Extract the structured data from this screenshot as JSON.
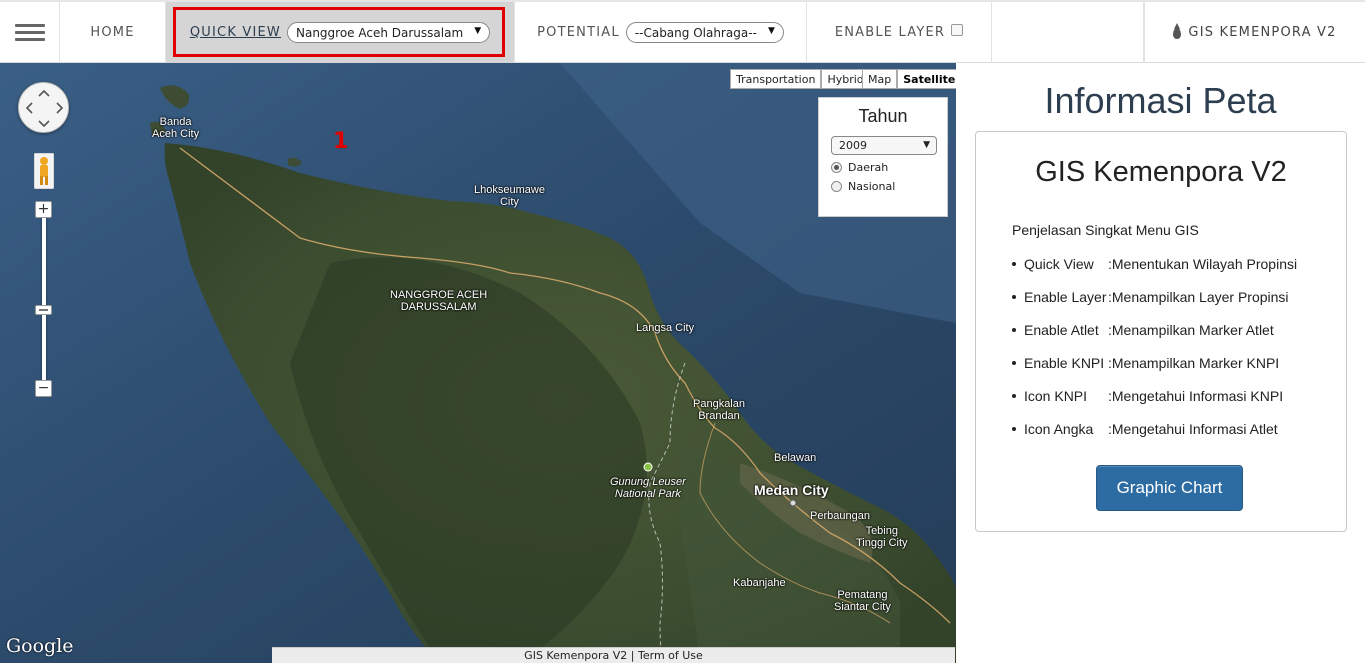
{
  "nav": {
    "home": "HOME",
    "quick_view_label": "QUICK VIEW",
    "quick_view_value": "Nanggroe Aceh Darussalam",
    "potential_label": "POTENTIAL",
    "potential_value": "--Cabang Olahraga--",
    "enable_layer_label": "ENABLE LAYER",
    "brand": "GIS KEMENPORA V2",
    "enable_layer_checked": false
  },
  "annotation": {
    "marker": "1",
    "color": "#e00000"
  },
  "map": {
    "map_types_left": [
      "Transportation",
      "Hybrid"
    ],
    "map_types_right": [
      "Map",
      "Satellite"
    ],
    "active_map_type": "Satellite",
    "tahun": {
      "title": "Tahun",
      "selected_year": "2009",
      "options": [
        "Daerah",
        "Nasional"
      ],
      "selected_option": "Daerah"
    },
    "labels": {
      "banda_aceh": "Banda\nAceh City",
      "lhokseumawe": "Lhokseumawe\nCity",
      "region": "NANGGROE ACEH\nDARUSSALAM",
      "langsa": "Langsa City",
      "pangkalan": "Pangkalan\nBrandan",
      "belawan": "Belawan",
      "leuser": "Gunung Leuser\nNational Park",
      "medan": "Medan City",
      "perbaungan": "Perbaungan",
      "tebing": "Tebing\nTinggi City",
      "kabanjahe": "Kabanjahe",
      "pematang": "Pematang\nSiantar City"
    },
    "google": "Google",
    "footer": "GIS Kemenpora V2 | Term of Use"
  },
  "info": {
    "title": "Informasi Peta",
    "card_title": "GIS Kemenpora V2",
    "subtitle": "Penjelasan Singkat Menu GIS",
    "menu": [
      {
        "name": "Quick View",
        "desc": ":Menentukan Wilayah Propinsi"
      },
      {
        "name": "Enable Layer",
        "desc": ":Menampilkan Layer Propinsi"
      },
      {
        "name": "Enable Atlet",
        "desc": ":Menampilkan Marker Atlet"
      },
      {
        "name": "Enable KNPI",
        "desc": ":Menampilkan Marker KNPI"
      },
      {
        "name": "Icon KNPI",
        "desc": ":Mengetahui Informasi KNPI"
      },
      {
        "name": "Icon Angka",
        "desc": ":Mengetahui Informasi Atlet"
      }
    ],
    "chart_button": "Graphic Chart"
  },
  "colors": {
    "accent": "#2d6ca2",
    "highlight": "#e00000",
    "title": "#2d3e50"
  }
}
